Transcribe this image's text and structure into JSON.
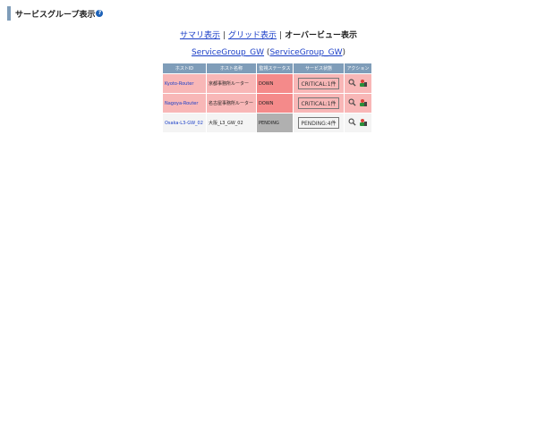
{
  "header": {
    "title": "サービスグループ表示",
    "help_icon": "?"
  },
  "view_links": {
    "summary": "サマリ表示",
    "grid": "グリッド表示",
    "overview": "オーバービュー表示",
    "separator": "|"
  },
  "group": {
    "name": "ServiceGroup_GW",
    "alias": "ServiceGroup_GW",
    "open_paren": "(",
    "close_paren": ")"
  },
  "table": {
    "headers": {
      "host_id": "ホストID",
      "host_name": "ホスト名称",
      "monitor_status": "監視ステータス",
      "service_status": "サービス状態",
      "action": "アクション"
    },
    "rows": [
      {
        "host_id": "Kyoto-Router",
        "host_name": "京都事務所ルーター",
        "status": "DOWN",
        "service": "CRITICAL:1件"
      },
      {
        "host_id": "Nagoya-Router",
        "host_name": "名古屋事務所ルーター",
        "status": "DOWN",
        "service": "CRITICAL:1件"
      },
      {
        "host_id": "Osaka-L3-GW_02",
        "host_name": "大阪_L3_GW_02",
        "status": "PENDING",
        "service": "PENDING:4件"
      }
    ]
  },
  "icons": {
    "search": "search-icon",
    "host_action": "host-detail-icon",
    "help": "help-icon"
  },
  "colors": {
    "header_bar": "#7f9db9",
    "critical_row": "#f8b7b7",
    "down_cell": "#f48a8a",
    "pending_cell": "#b0b0b0",
    "link": "#1a3ec7"
  }
}
